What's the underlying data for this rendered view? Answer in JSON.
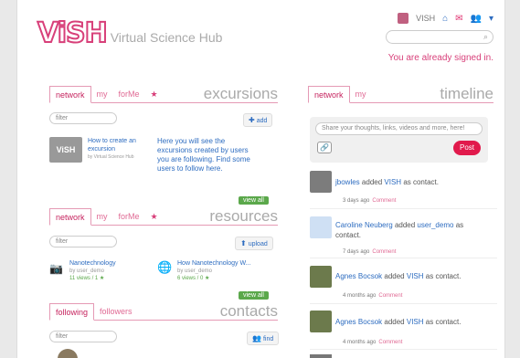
{
  "header": {
    "logo_mark": "ViSH",
    "logo_subtitle": "Virtual Science Hub",
    "user_name": "VISH",
    "search_placeholder": "",
    "signed_in_text": "You are already signed in."
  },
  "excursions": {
    "tabs": [
      "network",
      "my",
      "forMe",
      "★"
    ],
    "title": "excursions",
    "filter_placeholder": "filter",
    "add_label": "add",
    "item": {
      "title": "How to create an excursion",
      "author": "by Virtual Science Hub",
      "thumb_text": "ViSH"
    },
    "empty_message": "Here you will see the excursions created by users you are following. Find some users to follow here.",
    "view_all": "view all"
  },
  "resources": {
    "tabs": [
      "network",
      "my",
      "forMe",
      "★"
    ],
    "title": "resources",
    "filter_placeholder": "filter",
    "upload_label": "upload",
    "items": [
      {
        "title": "Nanotechnology",
        "author": "by user_demo",
        "stats": "11 views / 1 ★"
      },
      {
        "title": "How Nanotechnology W...",
        "author": "by user_demo",
        "stats": "6 views / 0 ★"
      }
    ],
    "view_all": "view all"
  },
  "contacts": {
    "tabs": [
      "following",
      "followers"
    ],
    "title": "contacts",
    "filter_placeholder": "filter",
    "find_label": "find"
  },
  "timeline": {
    "tabs": [
      "network",
      "my"
    ],
    "title": "timeline",
    "composer_placeholder": "Share your thoughts, links, videos and more, here!",
    "post_label": "Post",
    "feed": [
      {
        "actor": "jbowles",
        "action": "added",
        "target": "VISH",
        "suffix": "as contact.",
        "time": "3 days ago",
        "comment": "Comment"
      },
      {
        "actor": "Caroline Neuberg",
        "action": "added",
        "target": "user_demo",
        "suffix": "as contact.",
        "time": "7 days ago",
        "comment": "Comment"
      },
      {
        "actor": "Agnes Bocsok",
        "action": "added",
        "target": "VISH",
        "suffix": "as contact.",
        "time": "4 months ago",
        "comment": "Comment"
      },
      {
        "actor": "Agnes Bocsok",
        "action": "added",
        "target": "VISH",
        "suffix": "as contact.",
        "time": "4 months ago",
        "comment": "Comment"
      }
    ]
  },
  "colors": {
    "accent": "#d8407a",
    "link": "#2d6cc0",
    "post": "#e11a4c",
    "view_all": "#5ba84b"
  }
}
